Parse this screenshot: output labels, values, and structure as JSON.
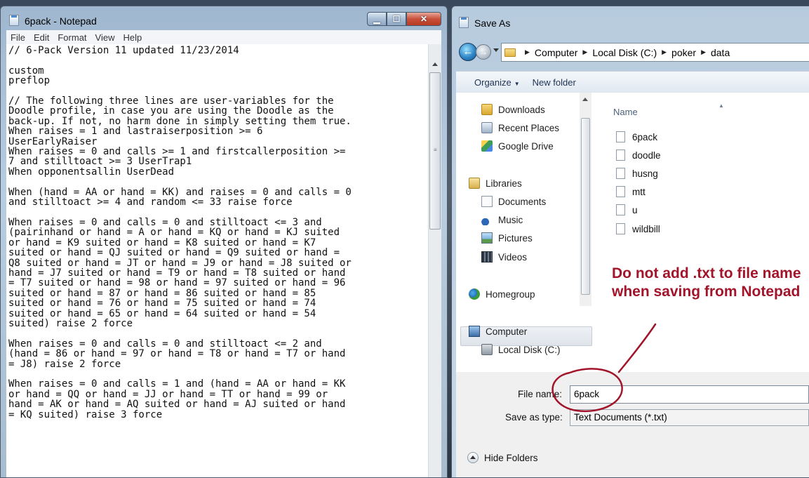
{
  "notepad": {
    "title": "6pack - Notepad",
    "menu": [
      "File",
      "Edit",
      "Format",
      "View",
      "Help"
    ],
    "content": "// 6-Pack Version 11 updated 11/23/2014\n\ncustom\npreflop\n\n// The following three lines are user-variables for the\nDoodle profile, in case you are using the Doodle as the\nback-up. If not, no harm done in simply setting them true.\nWhen raises = 1 and lastraiserposition >= 6\nUserEarlyRaiser\nWhen raises = 0 and calls >= 1 and firstcallerposition >=\n7 and stilltoact >= 3 UserTrap1\nWhen opponentsallin UserDead\n\nWhen (hand = AA or hand = KK) and raises = 0 and calls = 0\nand stilltoact >= 4 and random <= 33 raise force\n\nWhen raises = 0 and calls = 0 and stilltoact <= 3 and\n(pairinhand or hand = A or hand = KQ or hand = KJ suited\nor hand = K9 suited or hand = K8 suited or hand = K7\nsuited or hand = QJ suited or hand = Q9 suited or hand =\nQ8 suited or hand = JT or hand = J9 or hand = J8 suited or\nhand = J7 suited or hand = T9 or hand = T8 suited or hand\n= T7 suited or hand = 98 or hand = 97 suited or hand = 96\nsuited or hand = 87 or hand = 86 suited or hand = 85\nsuited or hand = 76 or hand = 75 suited or hand = 74\nsuited or hand = 65 or hand = 64 suited or hand = 54\nsuited) raise 2 force\n\nWhen raises = 0 and calls = 0 and stilltoact <= 2 and\n(hand = 86 or hand = 97 or hand = T8 or hand = T7 or hand\n= J8) raise 2 force\n\nWhen raises = 0 and calls = 1 and (hand = AA or hand = KK\nor hand = QQ or hand = JJ or hand = TT or hand = 99 or\nhand = AK or hand = AQ suited or hand = AJ suited or hand\n= KQ suited) raise 3 force"
  },
  "saveas": {
    "title": "Save As",
    "breadcrumb": [
      "Computer",
      "Local Disk (C:)",
      "poker",
      "data"
    ],
    "toolbar": {
      "organize": "Organize",
      "new_folder": "New folder"
    },
    "nav_items": [
      "Downloads",
      "Recent Places",
      "Google Drive",
      "Libraries",
      "Documents",
      "Music",
      "Pictures",
      "Videos",
      "Homegroup",
      "Computer",
      "Local Disk (C:)"
    ],
    "column_header": "Name",
    "files": [
      "6pack",
      "doodle",
      "husng",
      "mtt",
      "u",
      "wildbill"
    ],
    "file_name_label": "File name:",
    "file_name_value": "6pack",
    "save_type_label": "Save as type:",
    "save_type_value": "Text Documents (*.txt)",
    "hide_folders": "Hide Folders"
  },
  "annotation": "Do not add .txt to file name when saving from Notepad",
  "colors": {
    "annotation": "#a2142a",
    "window_frame": "#b7cbde"
  }
}
